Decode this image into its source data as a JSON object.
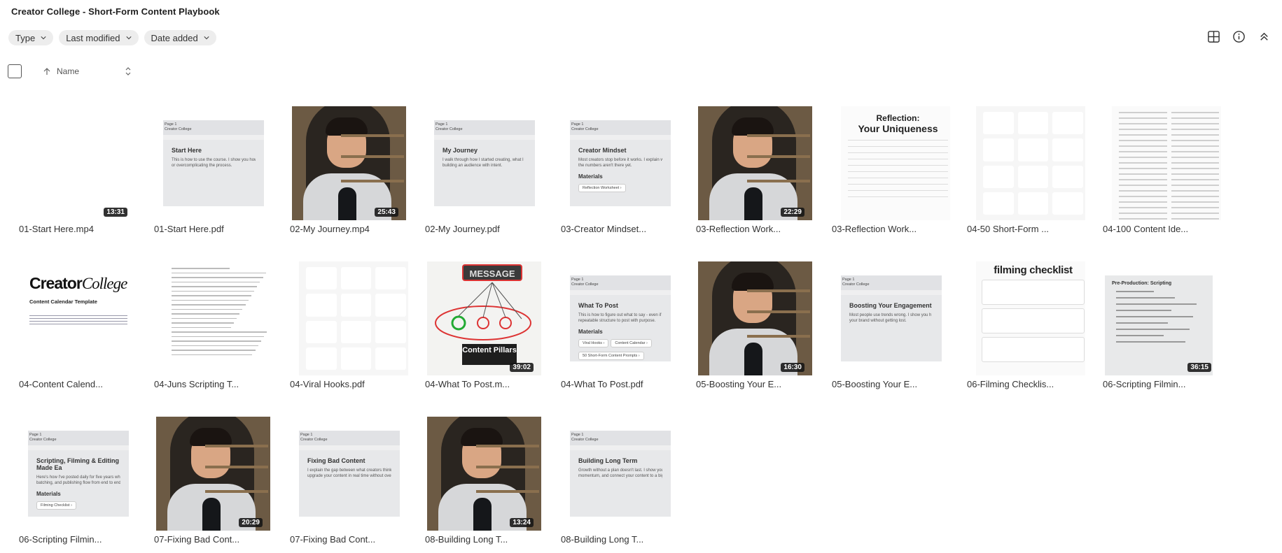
{
  "title": "Creator College - Short-Form Content Playbook",
  "filters": [
    "Type",
    "Last modified",
    "Date added"
  ],
  "toolbar": {
    "grid_icon": "grid-view-icon",
    "info_icon": "info-icon",
    "collapse_icon": "collapse-icon"
  },
  "sort": {
    "column": "Name"
  },
  "files": [
    {
      "name": "01-Start Here.mp4",
      "kind": "blank-video",
      "duration": "13:31"
    },
    {
      "name": "01-Start Here.pdf",
      "kind": "doc",
      "heading": "Start Here",
      "text": "This is how to use the course. I show you how",
      "text2": "or overcomplicating the process."
    },
    {
      "name": "02-My Journey.mp4",
      "kind": "video",
      "duration": "25:43"
    },
    {
      "name": "02-My Journey.pdf",
      "kind": "doc",
      "heading": "My Journey",
      "text": "I walk through how I started creating, what I",
      "text2": "building an audience with intent."
    },
    {
      "name": "03-Creator Mindset...",
      "kind": "doc-mat",
      "heading": "Creator Mindset",
      "text": "Most creators stop before it works. I explain what a",
      "text2": "the numbers aren't there yet.",
      "pills": [
        "Reflection Worksheet ›"
      ]
    },
    {
      "name": "03-Reflection Work...",
      "kind": "video",
      "duration": "22:29"
    },
    {
      "name": "03-Reflection Work...",
      "kind": "reflect",
      "r1": "Reflection:",
      "r2": "Your Uniqueness"
    },
    {
      "name": "04-50 Short-Form ...",
      "kind": "quotes"
    },
    {
      "name": "04-100 Content Ide...",
      "kind": "list2"
    },
    {
      "name": "04-Content Calend...",
      "kind": "ccal",
      "logo": "Creator",
      "logo2": "College",
      "sub": "Content Calendar Template"
    },
    {
      "name": "04-Juns Scripting T...",
      "kind": "script"
    },
    {
      "name": "04-Viral Hooks.pdf",
      "kind": "quotes"
    },
    {
      "name": "04-What To Post.m...",
      "kind": "whiteboard",
      "duration": "39:02",
      "msg": "MESSAGE",
      "pillars": "Content Pillars"
    },
    {
      "name": "04-What To Post.pdf",
      "kind": "doc-mat",
      "heading": "What To Post",
      "text": "This is how to figure out what to say - even if you think y",
      "text2": "repeatable structure to post with purpose.",
      "pills": [
        "Viral Hooks ›",
        "Content Calendar ›",
        "50 Short-Form Content Prompts ›"
      ]
    },
    {
      "name": "05-Boosting Your E...",
      "kind": "video",
      "duration": "16:30"
    },
    {
      "name": "05-Boosting Your E...",
      "kind": "doc",
      "heading": "Boosting Your Engagement",
      "text": "Most people use trends wrong. I show you h",
      "text2": "your brand without getting lost."
    },
    {
      "name": "06-Filming Checklis...",
      "kind": "check",
      "t": "filming checklist"
    },
    {
      "name": "06-Scripting Filmin...",
      "kind": "prod",
      "duration": "36:15",
      "heading": "Pre-Production: Scripting"
    },
    {
      "name": "06-Scripting Filmin...",
      "kind": "doc-mat",
      "heading": "Scripting, Filming & Editing Made Ea",
      "text": "Here's how I've posted daily for five years while ru",
      "text2": "batching, and publishing flow from end to end.",
      "pills": [
        "Filming Checklist ›"
      ]
    },
    {
      "name": "07-Fixing Bad Cont...",
      "kind": "video",
      "duration": "20:29"
    },
    {
      "name": "07-Fixing Bad Cont...",
      "kind": "doc",
      "heading": "Fixing Bad Content",
      "text": "I explain the gap between what creators think i",
      "text2": "upgrade your content in real time without over"
    },
    {
      "name": "08-Building Long T...",
      "kind": "video",
      "duration": "13:24"
    },
    {
      "name": "08-Building Long T...",
      "kind": "doc",
      "heading": "Building Long Term",
      "text": "Growth without a plan doesn't last. I show you h",
      "text2": "momentum, and connect your content to a bigge"
    }
  ],
  "doc_header": [
    "Page 1",
    "Creator College"
  ],
  "materials_label": "Materials"
}
